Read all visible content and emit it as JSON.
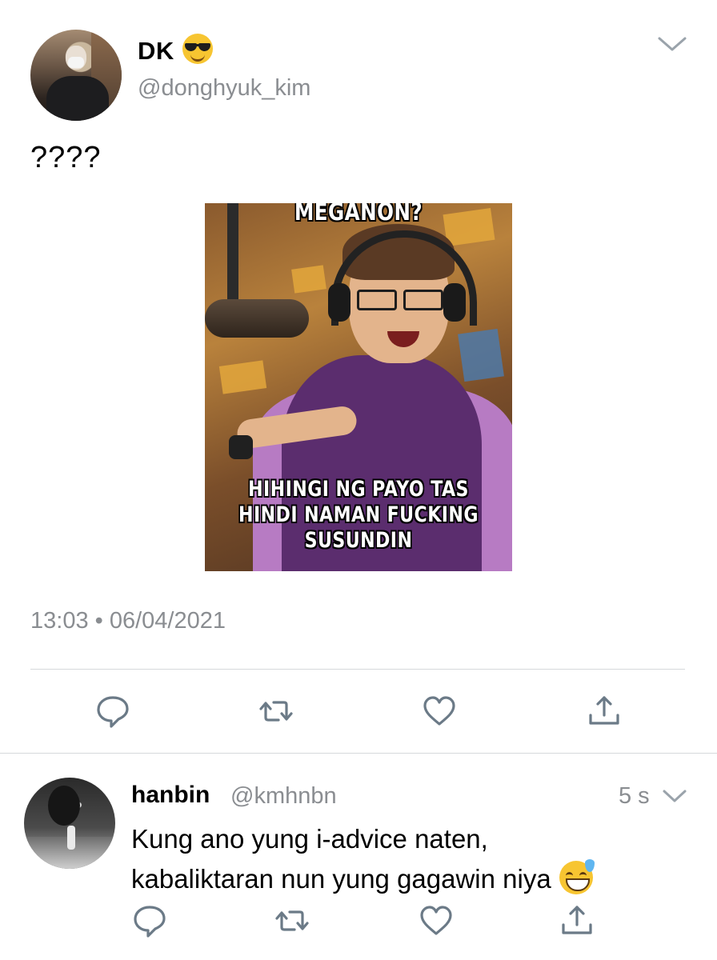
{
  "tweet": {
    "display_name": "DK",
    "display_name_emoji": "smiling-face-with-sunglasses",
    "handle": "@donghyuk_kim",
    "text": "????",
    "media": {
      "caption_top": "MEGANON?",
      "caption_bottom_line1": "HIHINGI NG PAYO TAS",
      "caption_bottom_line2": "HINDI NAMAN FUCKING",
      "caption_bottom_line3": "SUSUNDIN"
    },
    "timestamp": "13:03 • 06/04/2021",
    "actions": [
      "reply-icon",
      "retweet-icon",
      "like-icon",
      "share-icon"
    ]
  },
  "reply": {
    "display_name": "hanbin",
    "handle": "@kmhnbn",
    "time_ago": "5 s",
    "text_line1": "Kung ano yung i-advice naten,",
    "text_line2": "kabaliktaran nun yung gagawin niya",
    "text_emoji": "grinning-face-with-sweat",
    "actions": [
      "reply-icon",
      "retweet-icon",
      "like-icon",
      "share-icon"
    ]
  },
  "colors": {
    "secondary_text": "#8a8d91",
    "icon": "#6b7a87",
    "divider": "#d6d9db"
  }
}
